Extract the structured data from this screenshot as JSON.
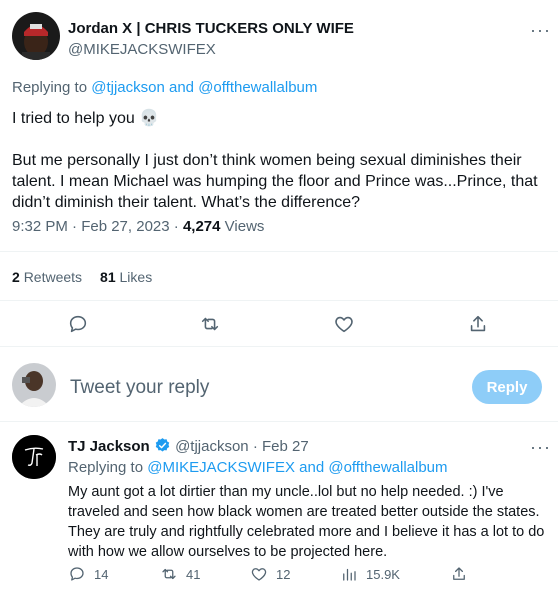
{
  "main_tweet": {
    "display_name": "Jordan X | CHRIS TUCKERS ONLY WIFE",
    "handle": "@MIKEJACKSWIFEX",
    "replying_prefix": "Replying to",
    "replying_user1": "@tjjackson",
    "replying_and": "and",
    "replying_user2": "@offthewallalbum",
    "para1": "I tried to help you 💀",
    "para2": "But me personally I just don’t think women being sexual diminishes their talent. I mean Michael was humping the floor and Prince was...Prince, that didn’t diminish their talent. What’s the difference?",
    "time": "9:32 PM · Feb 27, 2023 · ",
    "views_count": "4,274",
    "views_label": "Views",
    "retweets_count": "2",
    "retweets_label": "Retweets",
    "likes_count": "81",
    "likes_label": "Likes"
  },
  "composer": {
    "placeholder": "Tweet your reply",
    "reply_label": "Reply"
  },
  "reply_tweet": {
    "display_name": "TJ Jackson",
    "handle": "@tjjackson",
    "separator": "·",
    "date": "Feb 27",
    "replying_prefix": "Replying to",
    "replying_user1": "@MIKEJACKSWIFEX",
    "replying_and": "and",
    "replying_user2": "@offthewallalbum",
    "body": "My aunt got a lot dirtier than my uncle..lol but no help needed. :) I've traveled and seen how black women are treated better outside the states. They are truly and rightfully celebrated more and I believe it has a lot to do with how we allow ourselves to be projected here.",
    "replies": "14",
    "retweets": "41",
    "likes": "12",
    "views": "15.9K"
  },
  "more_glyph": "···",
  "colors": {
    "accent": "#1d9bf0",
    "secondary_text": "#536471",
    "divider": "#eff3f4",
    "reply_button": "#8ecdf8"
  },
  "icons": [
    "more-icon",
    "reply-icon",
    "retweet-icon",
    "like-icon",
    "share-icon",
    "verified-badge-icon",
    "views-icon"
  ]
}
